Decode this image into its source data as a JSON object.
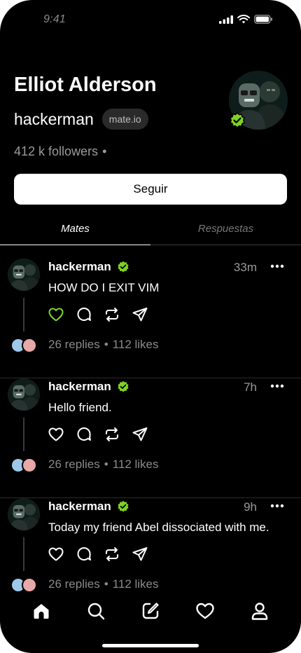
{
  "status_bar": {
    "time": "9:41"
  },
  "profile": {
    "name": "Elliot Alderson",
    "handle": "hackerman",
    "domain_badge": "mate.io",
    "followers": "412 k followers",
    "followers_sep": "•",
    "follow_button": "Seguir",
    "verified_color": "#7ed321"
  },
  "tabs": [
    {
      "label": "Mates",
      "active": true
    },
    {
      "label": "Respuestas",
      "active": false
    }
  ],
  "posts": [
    {
      "author": "hackerman",
      "time": "33m",
      "text": "HOW DO I EXIT VIM",
      "replies": "26 replies",
      "sep": "•",
      "likes": "112 likes",
      "liked": true
    },
    {
      "author": "hackerman",
      "time": "7h",
      "text": "Hello friend.",
      "replies": "26 replies",
      "sep": "•",
      "likes": "112 likes",
      "liked": false
    },
    {
      "author": "hackerman",
      "time": "9h",
      "text": "Today my friend Abel dissociated with me.",
      "replies": "26 replies",
      "sep": "•",
      "likes": "112 likes",
      "liked": false
    }
  ],
  "bottom_nav": [
    "home-icon",
    "search-icon",
    "compose-icon",
    "heart-icon",
    "profile-icon"
  ],
  "colors": {
    "background": "#000000",
    "accent_green": "#7ed321",
    "muted": "#9a9a9a"
  }
}
